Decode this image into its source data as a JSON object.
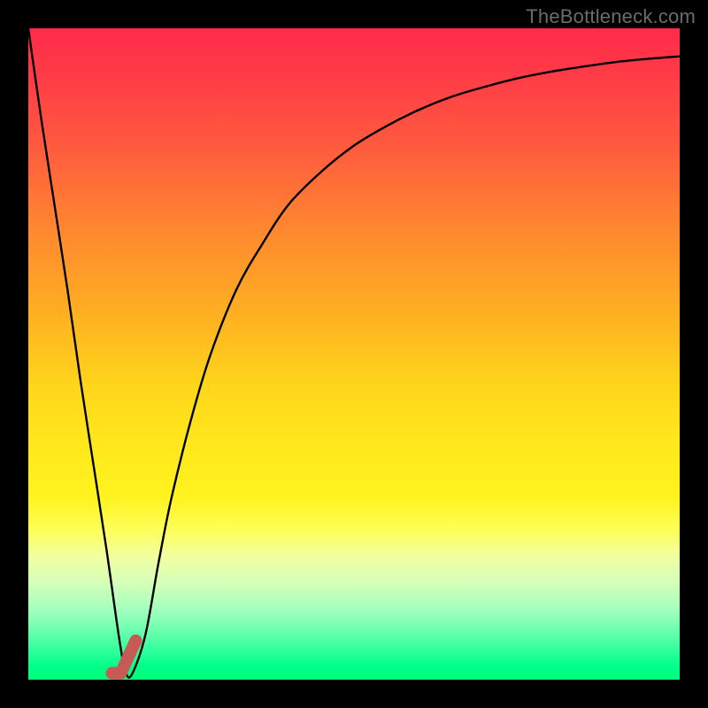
{
  "attribution": "TheBottleneck.com",
  "colors": {
    "frame": "#000000",
    "curve": "#000000",
    "marker": "#c85a56",
    "gradient_top": "#ff2a4a",
    "gradient_bottom": "#00ff7a"
  },
  "chart_data": {
    "type": "line",
    "title": "",
    "xlabel": "",
    "ylabel": "",
    "xlim": [
      0,
      100
    ],
    "ylim": [
      0,
      100
    ],
    "grid": false,
    "legend": false,
    "series": [
      {
        "name": "bottleneck-curve",
        "x": [
          0,
          2,
          4,
          6,
          8,
          10,
          12,
          14,
          15,
          16,
          18,
          20,
          22,
          25,
          28,
          32,
          36,
          40,
          45,
          50,
          55,
          60,
          65,
          70,
          75,
          80,
          85,
          90,
          95,
          100
        ],
        "y": [
          100,
          86,
          73,
          60,
          46,
          33,
          20,
          6,
          1,
          1,
          7,
          18,
          28,
          40,
          50,
          60,
          67,
          73,
          78,
          82,
          85,
          87.5,
          89.5,
          91,
          92.3,
          93.3,
          94.1,
          94.8,
          95.3,
          95.7
        ]
      }
    ],
    "marker": {
      "name": "bottleneck-minimum",
      "x_start": 14.2,
      "y_start": 1.0,
      "x_end": 16.5,
      "y_end": 6.0
    }
  }
}
